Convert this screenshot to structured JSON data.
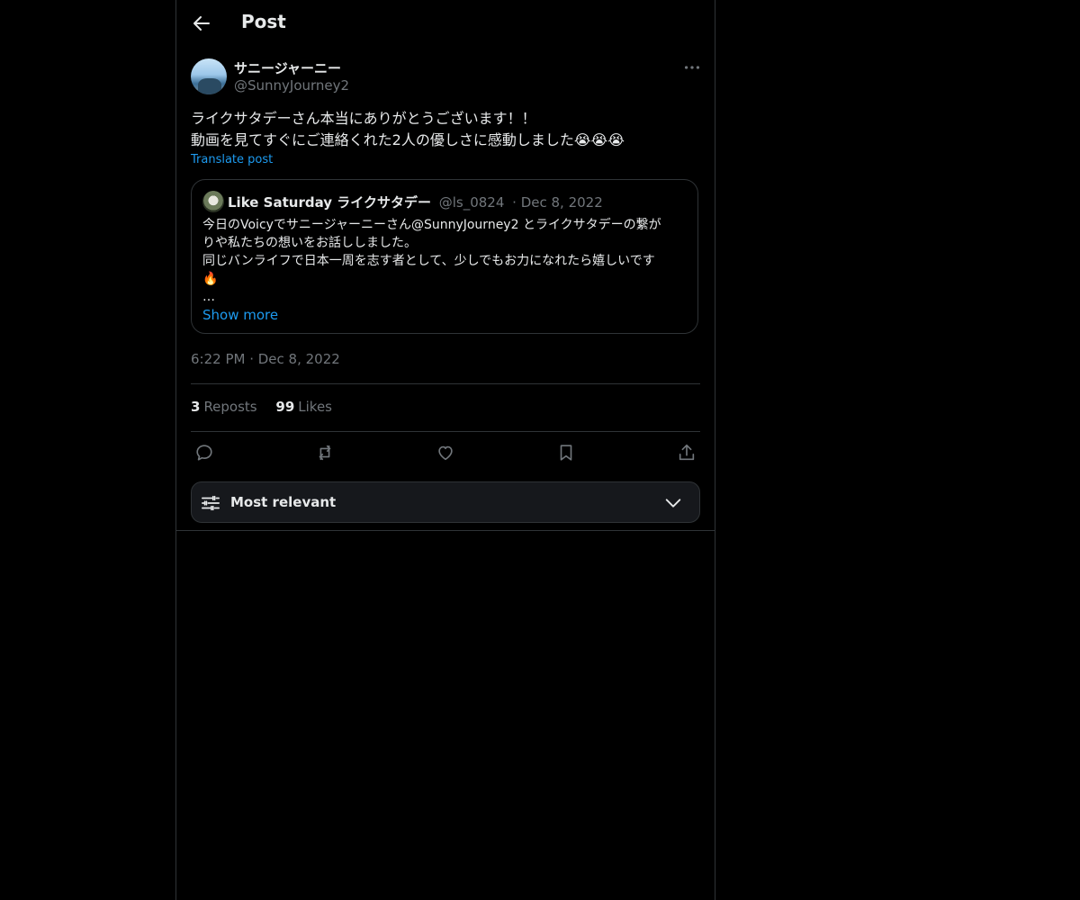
{
  "header": {
    "title": "Post",
    "back_icon": "arrow-left-icon"
  },
  "post": {
    "author_name": "サニージャーニー",
    "author_handle": "@SunnyJourney2",
    "text_lines": [
      "ライクサタデーさん本当にありがとうございます！！",
      "動画を見てすぐにご連絡くれた2人の優しさに感動しました😭😭😭"
    ],
    "translate_label": "Translate post",
    "timestamp": "6:22 PM · Dec 8, 2022",
    "stats": {
      "reposts_count": "3",
      "reposts_label": "Reposts",
      "likes_count": "99",
      "likes_label": "Likes"
    }
  },
  "quote": {
    "author_name": "Like Saturday ライクサタデー",
    "author_handle": "@ls_0824",
    "date": "· Dec 8, 2022",
    "text_lines": [
      "今日のVoicyでサニージャーニーさん@SunnyJourney2 とライクサタデーの繋が",
      "りや私たちの想いをお話ししました。",
      "同じバンライフで日本一周を志す者として、少しでもお力になれたら嬉しいです",
      "🔥",
      "…"
    ],
    "show_more_label": "Show more"
  },
  "actions": [
    "reply-icon",
    "repost-icon",
    "like-icon",
    "bookmark-icon",
    "share-icon"
  ],
  "sort": {
    "label": "Most relevant"
  },
  "colors": {
    "background": "#000000",
    "text": "#e7e9ea",
    "muted": "#71767b",
    "accent": "#1d9bf0",
    "border": "#2f3336"
  }
}
